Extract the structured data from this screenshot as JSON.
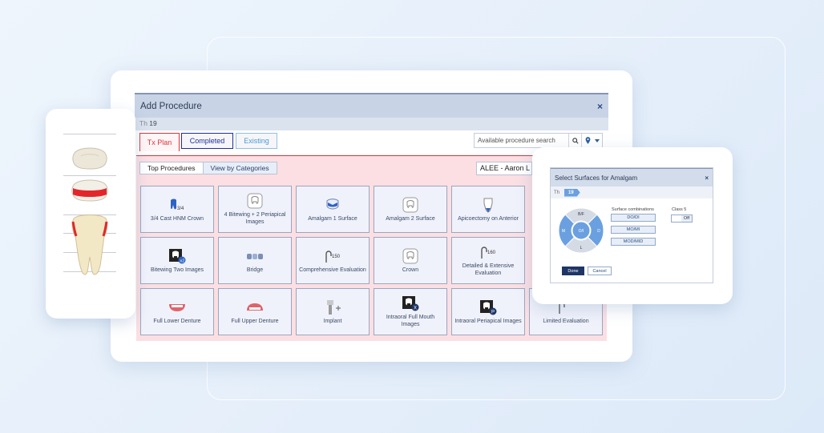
{
  "dialog": {
    "title": "Add Procedure",
    "close_glyph": "×",
    "tooth_prefix": "Th",
    "tooth_number": "19"
  },
  "tabs": [
    {
      "label": "Tx Plan",
      "color": "#d9343a"
    },
    {
      "label": "Completed",
      "color": "#1f2f9a"
    },
    {
      "label": "Existing",
      "color": "#4a9ad0"
    }
  ],
  "search": {
    "placeholder": "Available procedure search",
    "search_icon": "search-icon",
    "location_icon": "map-pin-icon",
    "dropdown_icon": "caret-down-icon"
  },
  "subtabs": {
    "top": "Top Procedures",
    "categories": "View by Categories"
  },
  "provider": "ALEE - Aaron L",
  "procedures": [
    {
      "label": "3/4 Cast HNM Crown",
      "icon": "crown-icon"
    },
    {
      "label": "4 Bitewing + 2 Periapical Images",
      "icon": "tooth-outline-icon"
    },
    {
      "label": "Amalgam 1 Surface",
      "icon": "filling-icon"
    },
    {
      "label": "Amalgam 2 Surface",
      "icon": "tooth-outline-icon"
    },
    {
      "label": "Apicoectomy on Anterior",
      "icon": "root-tooth-icon"
    },
    {
      "label": "Bitewing Two Images",
      "icon": "xray-film-icon"
    },
    {
      "label": "Bridge",
      "icon": "bridge-icon"
    },
    {
      "label": "Comprehensive Evaluation",
      "icon": "probe-icon"
    },
    {
      "label": "Crown",
      "icon": "tooth-outline-icon"
    },
    {
      "label": "Detailed & Extensive Evaluation",
      "icon": "probe-icon"
    },
    {
      "label": "Full Lower Denture",
      "icon": "denture-icon"
    },
    {
      "label": "Full Upper Denture",
      "icon": "denture-icon"
    },
    {
      "label": "Implant",
      "icon": "implant-icon"
    },
    {
      "label": "Intraoral Full Mouth Images",
      "icon": "xray-film-icon"
    },
    {
      "label": "Intraoral Periapical Images",
      "icon": "xray-film-icon"
    },
    {
      "label": "Limited Evaluation",
      "icon": "probe-icon"
    }
  ],
  "surfaces_dialog": {
    "title": "Select Surfaces for Amalgam",
    "close_glyph": "×",
    "tooth_prefix": "Th",
    "tooth_number": "19",
    "wheel": {
      "top": "B/F",
      "left": "M",
      "center": "O/I",
      "right": "D",
      "bottom": "L"
    },
    "combinations_label": "Surface combinations",
    "combinations": [
      "DO/DI",
      "MO/MI",
      "MOD/MID"
    ],
    "class5_label": "Class 5",
    "class5_value": "Off",
    "done": "Done",
    "cancel": "Cancel"
  },
  "colors": {
    "tx_plan": "#d9343a",
    "completed": "#1f2f9a",
    "existing": "#4a9ad0",
    "accent_blue": "#6aa0e0",
    "pink_area": "#fbdfe3"
  }
}
